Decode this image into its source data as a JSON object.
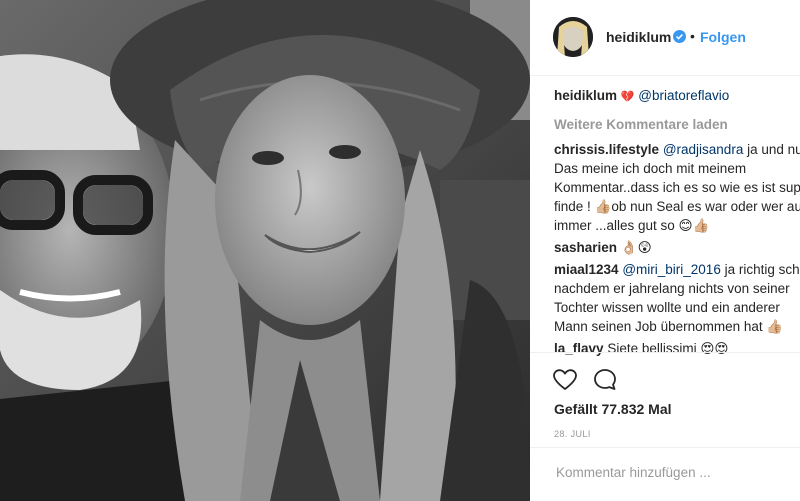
{
  "post": {
    "username": "heidiklum",
    "follow_label": "Folgen",
    "dot": "•",
    "caption_user": "heidiklum",
    "caption_emoji": "💔",
    "caption_mention": "@briatoreflavio",
    "load_more": "Weitere Kommentare laden",
    "comments": [
      {
        "user": "chrissis.lifestyle",
        "mention": "@radjisandra",
        "first_tail": " ja und nu",
        "lines": [
          "Das meine ich doch mit meinem",
          "Kommentar..dass ich es so wie es ist sup",
          "finde ! 👍🏼ob nun Seal es war oder wer au",
          "immer ...alles gut so 😊👍🏼"
        ]
      },
      {
        "user": "sasharien",
        "text": "👌🏼😲"
      },
      {
        "user": "miaal1234",
        "mention": "@miri_biri_2016",
        "first_tail": " ja richtig sch",
        "lines": [
          "nachdem er jahrelang nichts von seiner",
          "Tochter wissen wollte und ein anderer",
          "Mann seinen Job übernommen hat 👍🏼"
        ]
      },
      {
        "user": "la_flavy",
        "text": "Siete bellissimi 😍😍"
      }
    ],
    "likes": "Gefällt 77.832 Mal",
    "date": "28. JULI",
    "comment_placeholder": "Kommentar hinzufügen ...",
    "icons": [
      "heart-icon",
      "comment-icon",
      "verified-icon"
    ],
    "colors": {
      "accent": "#3897f0",
      "mention": "#003569",
      "muted": "#999999"
    }
  }
}
